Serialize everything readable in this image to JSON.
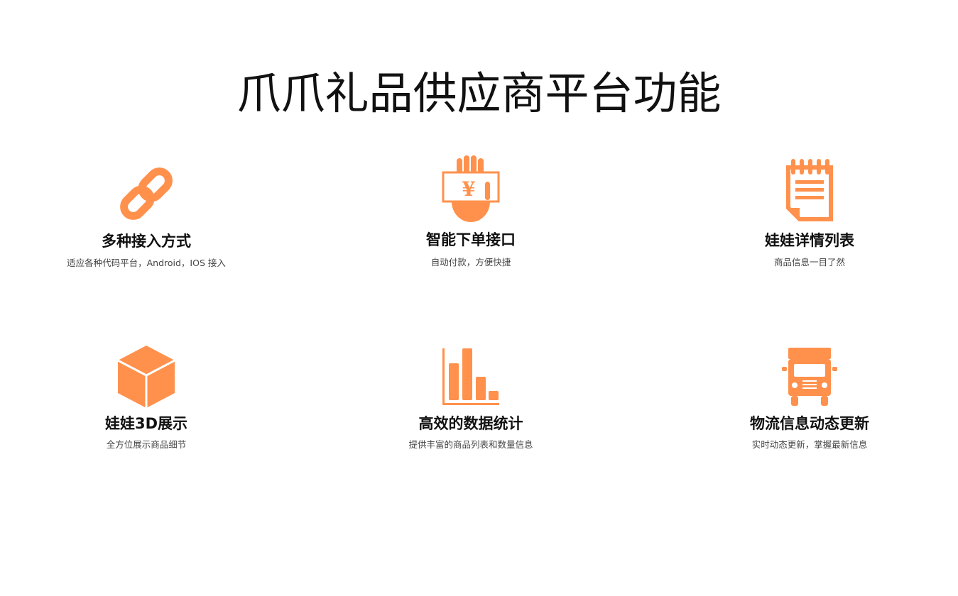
{
  "title": "爪爪礼品供应商平台功能",
  "accent_color": "#FF914D",
  "features": [
    {
      "icon": "link-icon",
      "title": "多种接入方式",
      "desc": "适应各种代码平台，Android，IOS 接入"
    },
    {
      "icon": "payment-hand-icon",
      "title": "智能下单接口",
      "desc": "自动付款，方便快捷"
    },
    {
      "icon": "notepad-icon",
      "title": "娃娃详情列表",
      "desc": "商品信息一目了然"
    },
    {
      "icon": "cube-icon",
      "title": "娃娃3D展示",
      "desc": "全方位展示商品细节"
    },
    {
      "icon": "bar-chart-icon",
      "title": "高效的数据统计",
      "desc": "提供丰富的商品列表和数量信息"
    },
    {
      "icon": "truck-icon",
      "title": "物流信息动态更新",
      "desc": "实时动态更新，掌握最新信息"
    }
  ]
}
